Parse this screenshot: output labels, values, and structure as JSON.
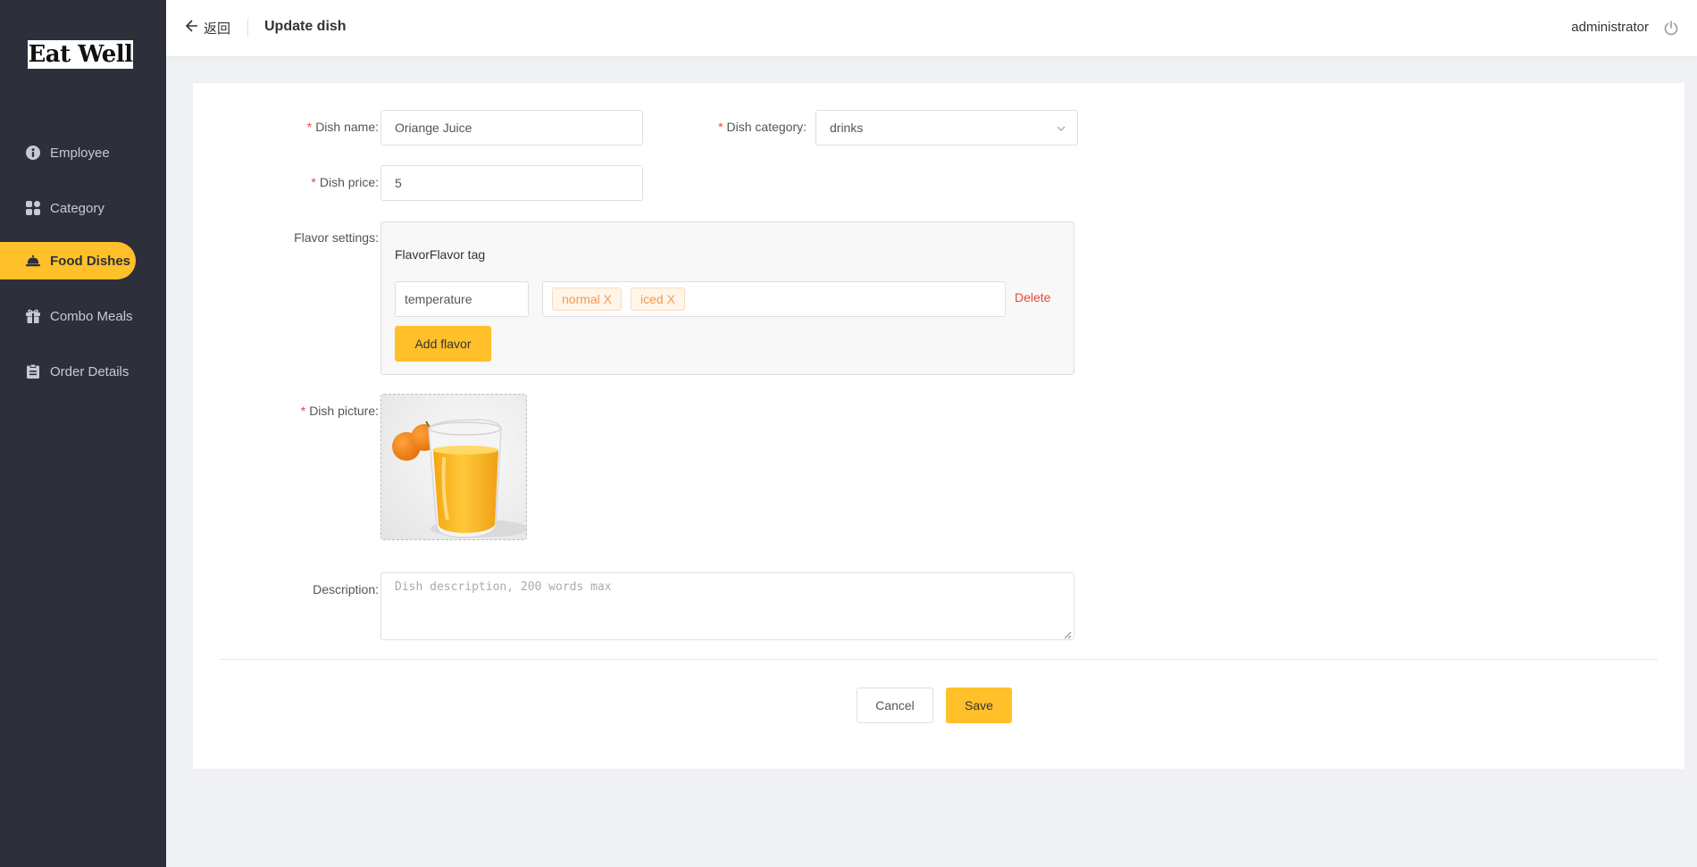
{
  "app": {
    "logo_text": "Eat Well"
  },
  "sidebar": {
    "items": [
      {
        "label": "Employee",
        "icon": "employee-icon"
      },
      {
        "label": "Category",
        "icon": "grid-icon"
      },
      {
        "label": "Food Dishes",
        "icon": "food-bell-icon",
        "active": true
      },
      {
        "label": "Combo Meals",
        "icon": "gift-icon"
      },
      {
        "label": "Order Details",
        "icon": "clipboard-icon"
      }
    ]
  },
  "header": {
    "back_label": "返回",
    "title": "Update dish",
    "username": "administrator"
  },
  "form": {
    "dish_name": {
      "label": "Dish name:",
      "value": "Oriange Juice",
      "required": true
    },
    "dish_category": {
      "label": "Dish category:",
      "value": "drinks",
      "required": true
    },
    "dish_price": {
      "label": "Dish price:",
      "value": "5",
      "required": true
    },
    "flavor": {
      "label": "Flavor settings:",
      "header": "FlavorFlavor tag",
      "rows": [
        {
          "name": "temperature",
          "tags": [
            "normal X",
            "iced X"
          ],
          "delete_label": "Delete"
        }
      ],
      "add_label": "Add flavor"
    },
    "dish_picture": {
      "label": "Dish picture:",
      "required": true
    },
    "description": {
      "label": "Description:",
      "placeholder": "Dish description, 200 words max",
      "value": ""
    },
    "actions": {
      "cancel": "Cancel",
      "save": "Save"
    }
  },
  "colors": {
    "accent": "#ffc02a",
    "sidebar_bg": "#2d303a",
    "danger": "#e6483d",
    "tag_text": "#f19a57"
  }
}
